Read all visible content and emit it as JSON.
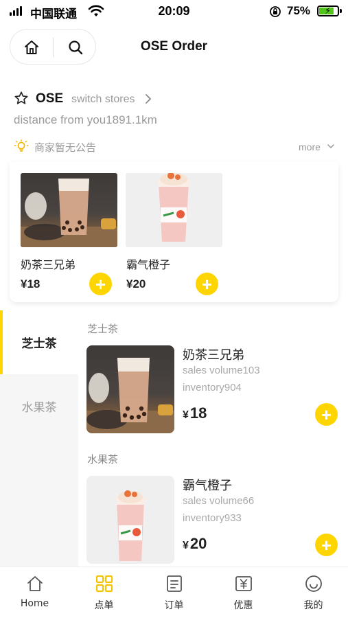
{
  "status_bar": {
    "carrier": "中国联通",
    "time": "20:09",
    "battery": "75%",
    "battery_level": 0.75
  },
  "nav": {
    "title": "OSE Order",
    "home_icon": "home-icon",
    "search_icon": "search-icon"
  },
  "store": {
    "name": "OSE",
    "switch_label": "switch stores",
    "distance": "distance from you1891.1km",
    "notice": "商家暂无公告",
    "more_label": "more"
  },
  "recommend": [
    {
      "name": "奶茶三兄弟",
      "price": "¥18"
    },
    {
      "name": "霸气橙子",
      "price": "¥20"
    }
  ],
  "categories": [
    {
      "label": "芝士茶",
      "active": true
    },
    {
      "label": "水果茶",
      "active": false
    }
  ],
  "sections": [
    {
      "title": "芝士茶",
      "product": {
        "name": "奶茶三兄弟",
        "sales": "sales volume103",
        "inventory": "inventory904",
        "currency": "¥",
        "price": "18"
      }
    },
    {
      "title": "水果茶",
      "product": {
        "name": "霸气橙子",
        "sales": "sales volume66",
        "inventory": "inventory933",
        "currency": "¥",
        "price": "20"
      }
    }
  ],
  "tabs": [
    {
      "label": "Home",
      "icon": "home-tab-icon"
    },
    {
      "label": "点单",
      "icon": "grid-tab-icon",
      "active": true
    },
    {
      "label": "订单",
      "icon": "order-tab-icon"
    },
    {
      "label": "优惠",
      "icon": "coupon-tab-icon"
    },
    {
      "label": "我的",
      "icon": "profile-tab-icon"
    }
  ],
  "colors": {
    "accent": "#ffd500",
    "muted_text": "#999999",
    "battery_green": "#52c41a"
  }
}
